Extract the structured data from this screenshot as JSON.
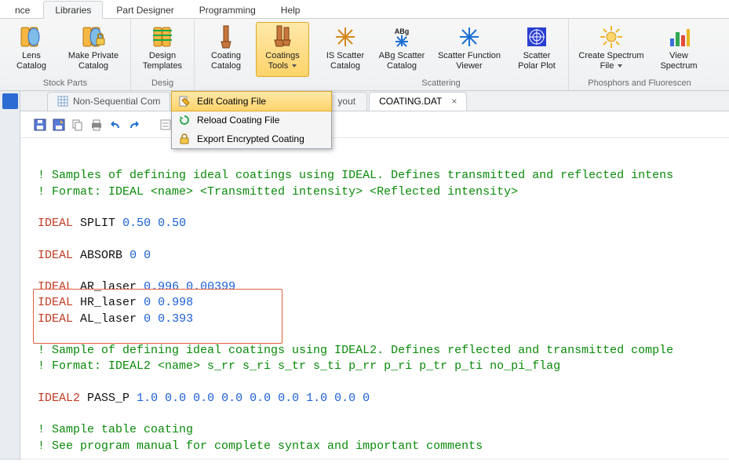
{
  "ribbon_tabs": {
    "t0": "nce",
    "t1": "Libraries",
    "t2": "Part Designer",
    "t3": "Programming",
    "t4": "Help"
  },
  "groups": {
    "stock": {
      "label": "Stock Parts",
      "lens_catalog": "Lens Catalog",
      "make_private": "Make Private Catalog"
    },
    "design": {
      "label": "Desig",
      "templates": "Design Templates"
    },
    "coating": {
      "catalog": "Coating Catalog",
      "tools": "Coatings Tools"
    },
    "scattering": {
      "label": "Scattering",
      "is_scatter": "IS Scatter Catalog",
      "abg_scatter": "ABg Scatter Catalog",
      "func_viewer": "Scatter Function Viewer",
      "polar": "Scatter Polar Plot"
    },
    "phosphor": {
      "label": "Phosphors and Fluorescen",
      "create_spectrum": "Create Spectrum File",
      "view_spectrum": "View Spectrum"
    }
  },
  "dropdown": {
    "edit": "Edit Coating File",
    "reload": "Reload Coating File",
    "export": "Export Encrypted Coating"
  },
  "doc_tabs": {
    "nsc": "Non-Sequential Com",
    "layout_tail": "yout",
    "coating": "COATING.DAT"
  },
  "code": {
    "l1": "! Samples of defining ideal coatings using IDEAL. Defines transmitted and reflected intens",
    "l2": "! Format: IDEAL <name> <Transmitted intensity> <Reflected intensity>",
    "split_k": "IDEAL",
    "split_n": "SPLIT",
    "split_v": "0.50 0.50",
    "absorb_k": "IDEAL",
    "absorb_n": "ABSORB",
    "absorb_v": "0 0",
    "ar_k": "IDEAL",
    "ar_n": "AR_laser",
    "ar_v": "0.996 0.00399",
    "hr_k": "IDEAL",
    "hr_n": "HR_laser",
    "hr_v": "0 0.998",
    "al_k": "IDEAL",
    "al_n": "AL_laser",
    "al_v": "0 0.393",
    "l3": "! Sample of defining ideal coatings using IDEAL2. Defines reflected and transmitted comple",
    "l4": "! Format: IDEAL2 <name> s_rr s_ri s_tr s_ti p_rr p_ri p_tr p_ti no_pi_flag",
    "pp_k": "IDEAL2",
    "pp_n": "PASS_P",
    "pp_v": "1.0 0.0 0.0 0.0 0.0 0.0 1.0 0.0 0",
    "l5": "! Sample table coating",
    "l6": "! See program manual for complete syntax and important comments"
  }
}
